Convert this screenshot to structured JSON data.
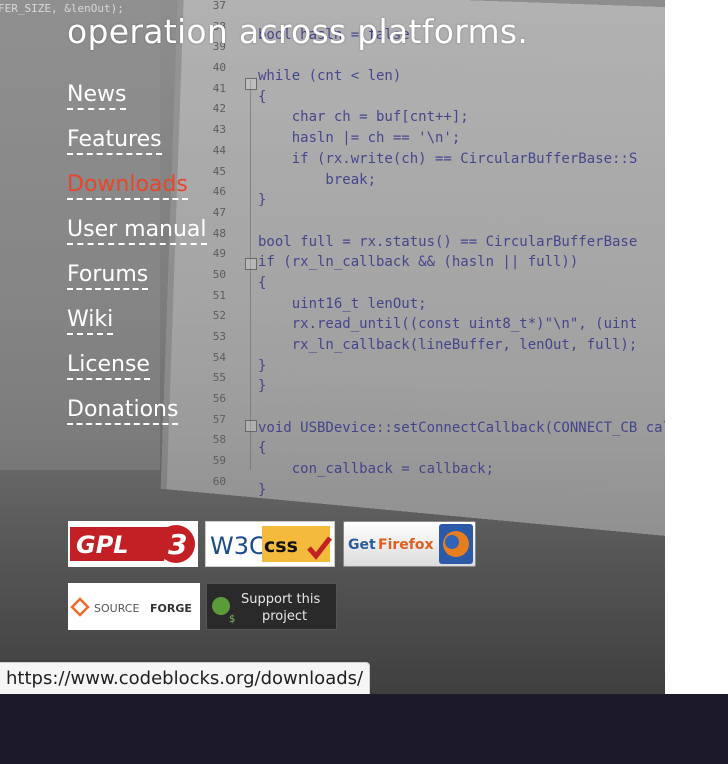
{
  "heading": "operation across platforms.",
  "nav": [
    {
      "label": "News",
      "active": false
    },
    {
      "label": "Features",
      "active": false
    },
    {
      "label": "Downloads",
      "active": true
    },
    {
      "label": "User manual",
      "active": false
    },
    {
      "label": "Forums",
      "active": false
    },
    {
      "label": "Wiki",
      "active": false
    },
    {
      "label": "License",
      "active": false
    },
    {
      "label": "Donations",
      "active": false
    }
  ],
  "background_code": {
    "top_fragment": "FER_SIZE, &lenOut);",
    "line_numbers": [
      "37",
      "38",
      "39",
      "40",
      "41",
      "42",
      "43",
      "44",
      "45",
      "46",
      "47",
      "48",
      "49",
      "50",
      "51",
      "52",
      "53",
      "54",
      "55",
      "56",
      "57",
      "58",
      "59",
      "60"
    ],
    "lines": [
      "",
      "bool hasln = false;",
      "",
      "while (cnt < len)",
      "{",
      "    char ch = buf[cnt++];",
      "    hasln |= ch == '\\n';",
      "    if (rx.write(ch) == CircularBufferBase::S",
      "        break;",
      "}",
      "",
      "bool full = rx.status() == CircularBufferBase",
      "if (rx_ln_callback && (hasln || full))",
      "{",
      "    uint16_t lenOut;",
      "    rx.read_until((const uint8_t*)\"\\n\", (uint",
      "    rx_ln_callback(lineBuffer, lenOut, full);",
      "}",
      "}",
      "",
      "void USBDevice::setConnectCallback(CONNECT_CB cal",
      "{",
      "    con_callback = callback;",
      "}"
    ]
  },
  "badges": {
    "gpl": {
      "text": "GPL",
      "version": "3"
    },
    "w3c": {
      "w3c": "W3C",
      "css": "css"
    },
    "firefox": {
      "get": "Get",
      "brand": "Firefox"
    },
    "sourceforge": {
      "source": "SOURCE",
      "forge": "FORGE"
    },
    "support": {
      "line1": "Support this",
      "line2": "project"
    }
  },
  "status_url": "https://www.codeblocks.org/downloads/",
  "colors": {
    "accent": "#e8452c",
    "footer": "#1c1a29"
  }
}
